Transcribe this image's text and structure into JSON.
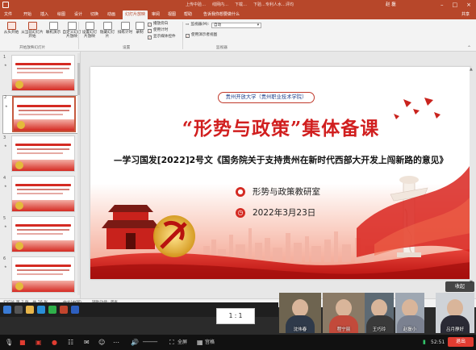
{
  "titlebar": {
    "tabs": [
      "上传中验…",
      "线网内…",
      "下载…",
      "下验…专利人水…评均"
    ],
    "user": "赵 磊"
  },
  "ribbon_tabs": [
    "文件",
    "开始",
    "插入",
    "绘图",
    "设计",
    "切换",
    "动画",
    "幻灯片放映",
    "审阅",
    "视图",
    "帮助",
    "告诉我你想要做什么"
  ],
  "active_tab_index": 7,
  "share_label": "共享",
  "ribbon": {
    "btn1": "从头开始",
    "btn2": "从当前幻灯片开始",
    "btn3": "联机演示",
    "btn4": "自定义幻灯片放映",
    "group1": "开始放映幻灯片",
    "btn5": "设置幻灯片放映",
    "btn6": "隐藏幻灯片",
    "btn7": "排练计时",
    "btn8": "录制",
    "chk1": "播放旁白",
    "chk2": "使用计时",
    "chk3": "显示媒体控件",
    "group2": "设置",
    "monitor_label": "监视器(M):",
    "monitor_value": "自动",
    "chk4": "使用演示者视图",
    "group3": "监视器"
  },
  "thumbnails": [
    {
      "num": "1",
      "selected": false
    },
    {
      "num": "2",
      "selected": true
    },
    {
      "num": "3",
      "selected": false
    },
    {
      "num": "4",
      "selected": false
    },
    {
      "num": "5",
      "selected": false
    },
    {
      "num": "6",
      "selected": false
    }
  ],
  "slide": {
    "badge": "贵州开放大学（贵州职业技术学院）",
    "title": "“形势与政策”集体备课",
    "subtitle": "—学习国发[2022]2号文《国务院关于支持贵州在新时代西部大开发上闯新路的意见》",
    "org": "形势与政策教研室",
    "date": "2022年3月23日"
  },
  "statusbar": {
    "slide_info": "幻灯片 第 2 张，共 16 张",
    "lang": "中文(中国)",
    "access": "辅助功能: 调查"
  },
  "meeting": {
    "collapse_label": "收起",
    "ratio_label": "1 : 1",
    "participants": [
      {
        "name": "沈伟春",
        "shirt": "#2f3a4a",
        "bg": "#6e6450"
      },
      {
        "name": "程宁丽",
        "shirt": "#c24a3b",
        "bg": "#8a7a66"
      },
      {
        "name": "王巧玲",
        "shirt": "#3a3a3a",
        "bg": "#5d6a74"
      },
      {
        "name": "赵磊小",
        "shirt": "#7b8190",
        "bg": "#9ea7b2"
      },
      {
        "name": "吕月静好",
        "shirt": "#2a2a35",
        "bg": "#cfd3d8"
      }
    ],
    "fullscreen_label": "全屏",
    "speaker_label": "宫格",
    "time": "52:51",
    "end_label": "退出"
  }
}
